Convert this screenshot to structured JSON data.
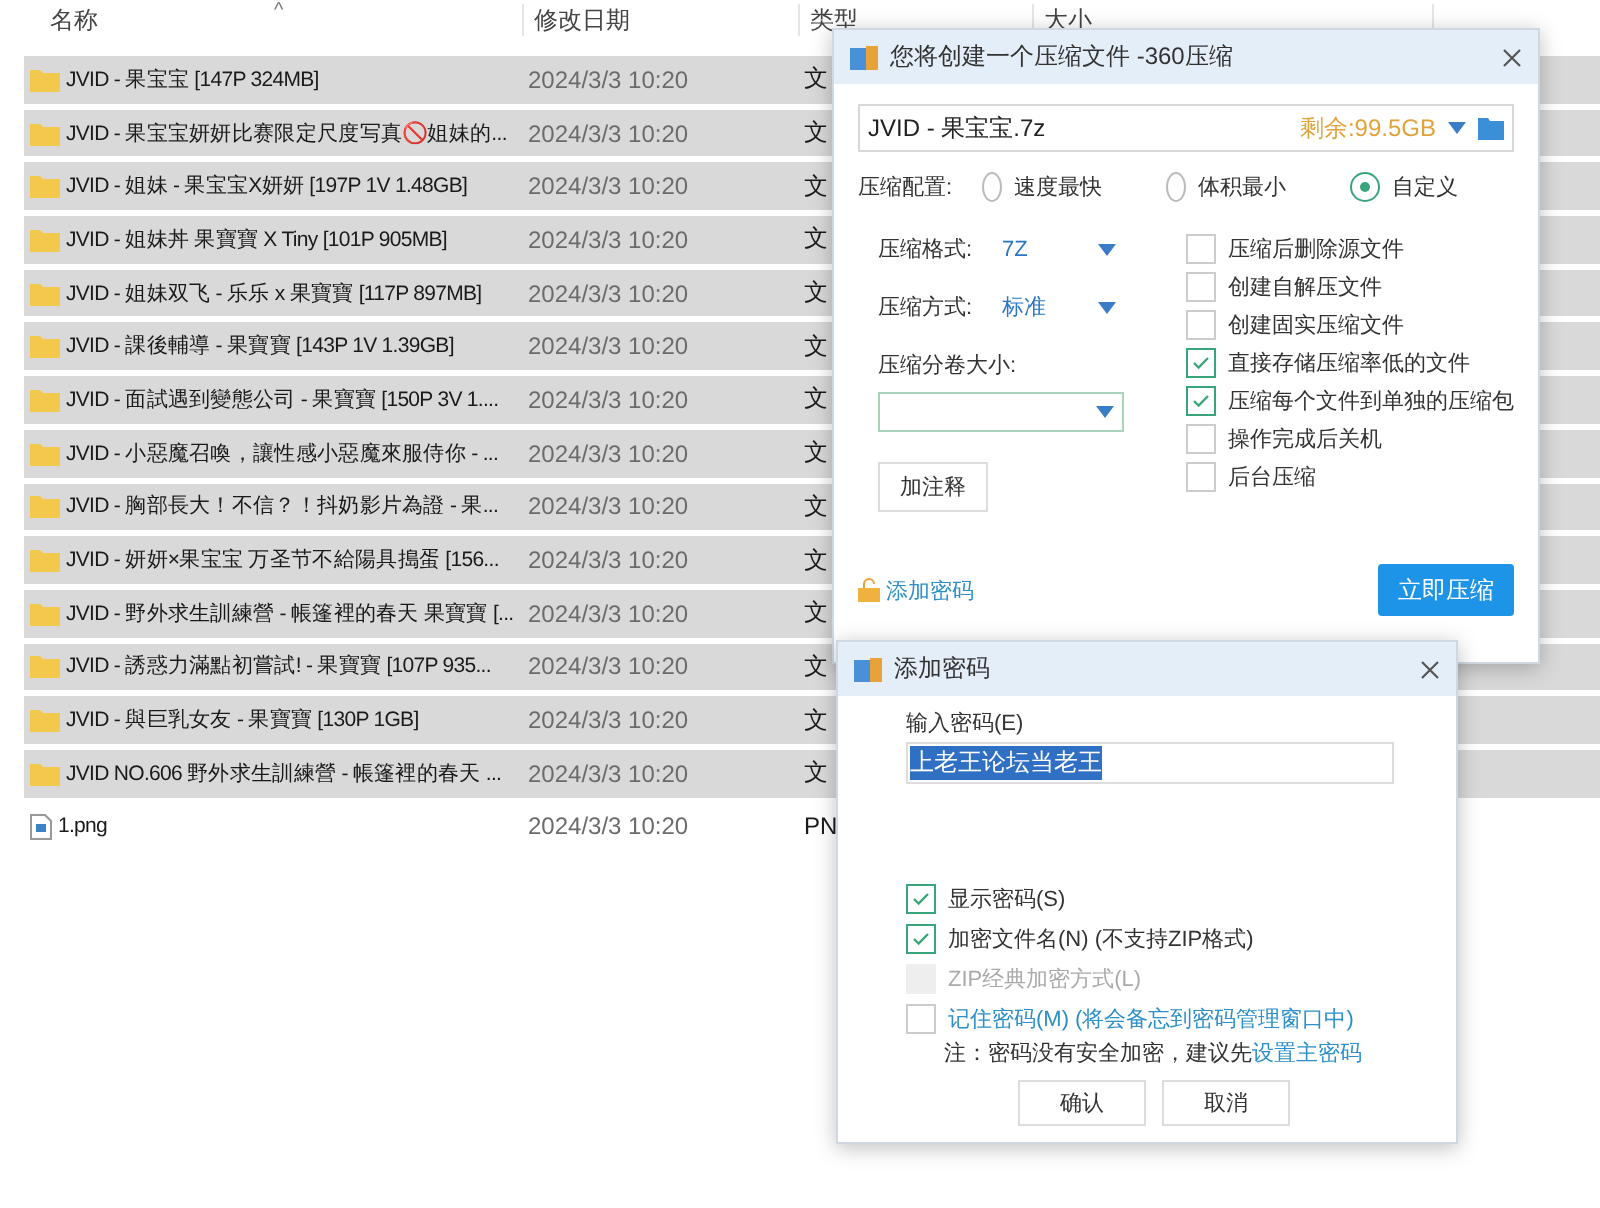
{
  "explorer": {
    "sort_caret": "^",
    "columns": [
      "名称",
      "修改日期",
      "类型",
      "大小"
    ],
    "rows": [
      {
        "kind": "folder",
        "name": "JVID - 果宝宝 [147P 324MB]",
        "date": "2024/3/3 10:20",
        "type": "文",
        "selected": true
      },
      {
        "kind": "folder",
        "name": "JVID - 果宝宝妍妍比赛限定尺度写真🚫姐妹的...",
        "date": "2024/3/3 10:20",
        "type": "文",
        "selected": true
      },
      {
        "kind": "folder",
        "name": "JVID - 姐妹 - 果宝宝X妍妍 [197P 1V 1.48GB]",
        "date": "2024/3/3 10:20",
        "type": "文",
        "selected": true
      },
      {
        "kind": "folder",
        "name": "JVID - 姐妹丼 果寶寶 X Tiny [101P 905MB]",
        "date": "2024/3/3 10:20",
        "type": "文",
        "selected": true
      },
      {
        "kind": "folder",
        "name": "JVID - 姐妹双飞 - 乐乐 x 果寶寶 [117P 897MB]",
        "date": "2024/3/3 10:20",
        "type": "文",
        "selected": true
      },
      {
        "kind": "folder",
        "name": "JVID - 課後輔導 - 果寶寶 [143P 1V 1.39GB]",
        "date": "2024/3/3 10:20",
        "type": "文",
        "selected": true
      },
      {
        "kind": "folder",
        "name": "JVID - 面試遇到變態公司 - 果寶寶 [150P 3V 1....",
        "date": "2024/3/3 10:20",
        "type": "文",
        "selected": true
      },
      {
        "kind": "folder",
        "name": "JVID - 小惡魔召喚，讓性感小惡魔來服侍你 - ...",
        "date": "2024/3/3 10:20",
        "type": "文",
        "selected": true
      },
      {
        "kind": "folder",
        "name": "JVID - 胸部長大！不信？！抖奶影片為證 - 果...",
        "date": "2024/3/3 10:20",
        "type": "文",
        "selected": true
      },
      {
        "kind": "folder",
        "name": "JVID - 妍妍×果宝宝 万圣节不給陽具搗蛋 [156...",
        "date": "2024/3/3 10:20",
        "type": "文",
        "selected": true
      },
      {
        "kind": "folder",
        "name": "JVID - 野外求生訓練營 - 帳篷裡的春天 果寶寶 [...",
        "date": "2024/3/3 10:20",
        "type": "文",
        "selected": true
      },
      {
        "kind": "folder",
        "name": "JVID - 誘惑力滿點初嘗試! - 果寶寶 [107P 935...",
        "date": "2024/3/3 10:20",
        "type": "文",
        "selected": true
      },
      {
        "kind": "folder",
        "name": "JVID - 與巨乳女友 - 果寶寶 [130P 1GB]",
        "date": "2024/3/3 10:20",
        "type": "文",
        "selected": true
      },
      {
        "kind": "folder",
        "name": "JVID NO.606 野外求生訓練營 - 帳篷裡的春天 ...",
        "date": "2024/3/3 10:20",
        "type": "文",
        "selected": true
      },
      {
        "kind": "file",
        "name": "1.png",
        "date": "2024/3/3 10:20",
        "type": "PN",
        "selected": false
      }
    ]
  },
  "compress_dialog": {
    "title": "您将创建一个压缩文件 -360压缩",
    "filename": "JVID - 果宝宝.7z",
    "free_space": "剩余:99.5GB",
    "config_label": "压缩配置:",
    "presets": [
      {
        "label": "速度最快",
        "selected": false
      },
      {
        "label": "体积最小",
        "selected": false
      },
      {
        "label": "自定义",
        "selected": true
      }
    ],
    "format_label": "压缩格式:",
    "format": "7Z",
    "method_label": "压缩方式:",
    "method": "标准",
    "split_label": "压缩分卷大小:",
    "comment_button": "加注释",
    "options": [
      {
        "label": "压缩后删除源文件",
        "checked": false
      },
      {
        "label": "创建自解压文件",
        "checked": false
      },
      {
        "label": "创建固实压缩文件",
        "checked": false
      },
      {
        "label": "直接存储压缩率低的文件",
        "checked": true
      },
      {
        "label": "压缩每个文件到单独的压缩包",
        "checked": true
      },
      {
        "label": "操作完成后关机",
        "checked": false
      },
      {
        "label": "后台压缩",
        "checked": false
      }
    ],
    "add_password": "添加密码",
    "compress_button": "立即压缩"
  },
  "password_dialog": {
    "title": "添加密码",
    "input_label": "输入密码(E)",
    "password": "上老王论坛当老王",
    "options": [
      {
        "kind": "plain",
        "label": "显示密码(S)",
        "checked": true,
        "disabled": false
      },
      {
        "kind": "plain",
        "label": "加密文件名(N) (不支持ZIP格式)",
        "checked": true,
        "disabled": false
      },
      {
        "kind": "plain",
        "label": "ZIP经典加密方式(L)",
        "checked": false,
        "disabled": true
      },
      {
        "kind": "link",
        "label": "记住密码(M) (将会备忘到密码管理窗口中)",
        "checked": false,
        "disabled": false
      }
    ],
    "note": "注：密码没有安全加密，建议先",
    "note_link": "设置主密码",
    "buttons": [
      "确认",
      "取消"
    ]
  }
}
